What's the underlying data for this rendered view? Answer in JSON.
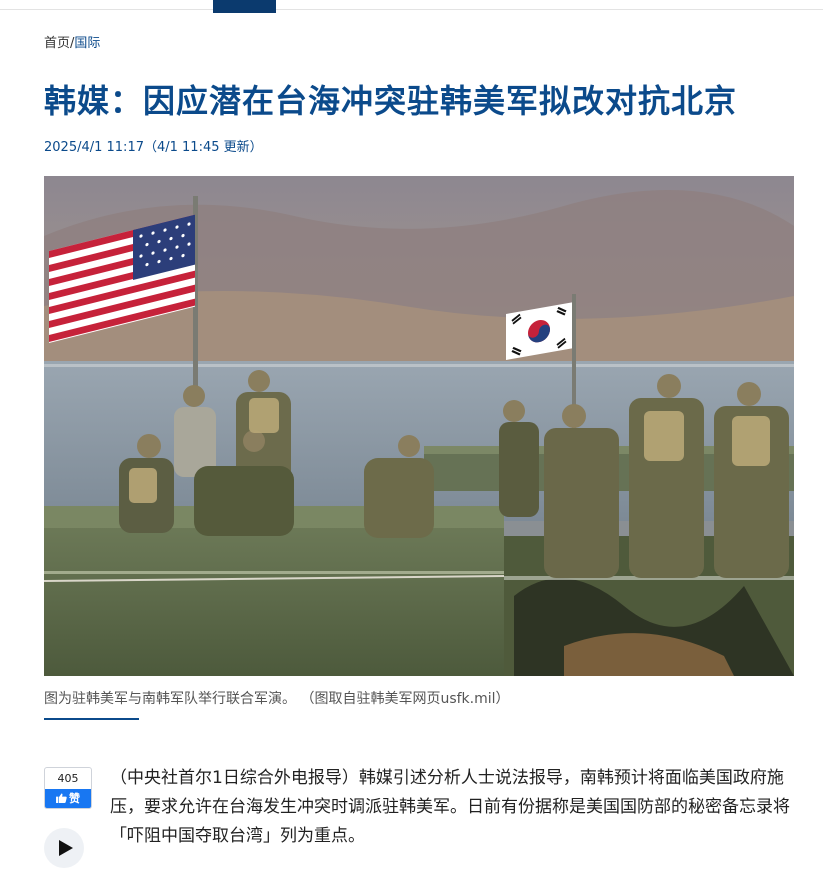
{
  "header": {
    "accent": "#0b3a6e"
  },
  "breadcrumb": {
    "home": "首页",
    "separator": "/",
    "current": "国际"
  },
  "article": {
    "title": "韩媒：因应潜在台海冲突驻韩美军拟改对抗北京",
    "dateline": "2025/4/1 11:17（4/1 11:45 更新）",
    "photo_caption": "图为驻韩美军与南韩军队举行联合军演。 （图取自驻韩美军网页usfk.mil）",
    "body_paragraphs": [
      "（中央社首尔1日综合外电报导）韩媒引述分析人士说法报导，南韩预计将面临美国政府施压，要求允许在台海发生冲突时调派驻韩美军。日前有份据称是美国国防部的秘密备忘录将「吓阻中国夺取台湾」列为重点。"
    ]
  },
  "social": {
    "like_count": "405",
    "like_label": "赞",
    "like_icon": "thumbs-up-icon",
    "like_color": "#1877f2"
  },
  "audio": {
    "play_icon": "play-icon"
  },
  "colors": {
    "title": "#0b4a8b",
    "text": "#222222",
    "caption": "#555555"
  }
}
